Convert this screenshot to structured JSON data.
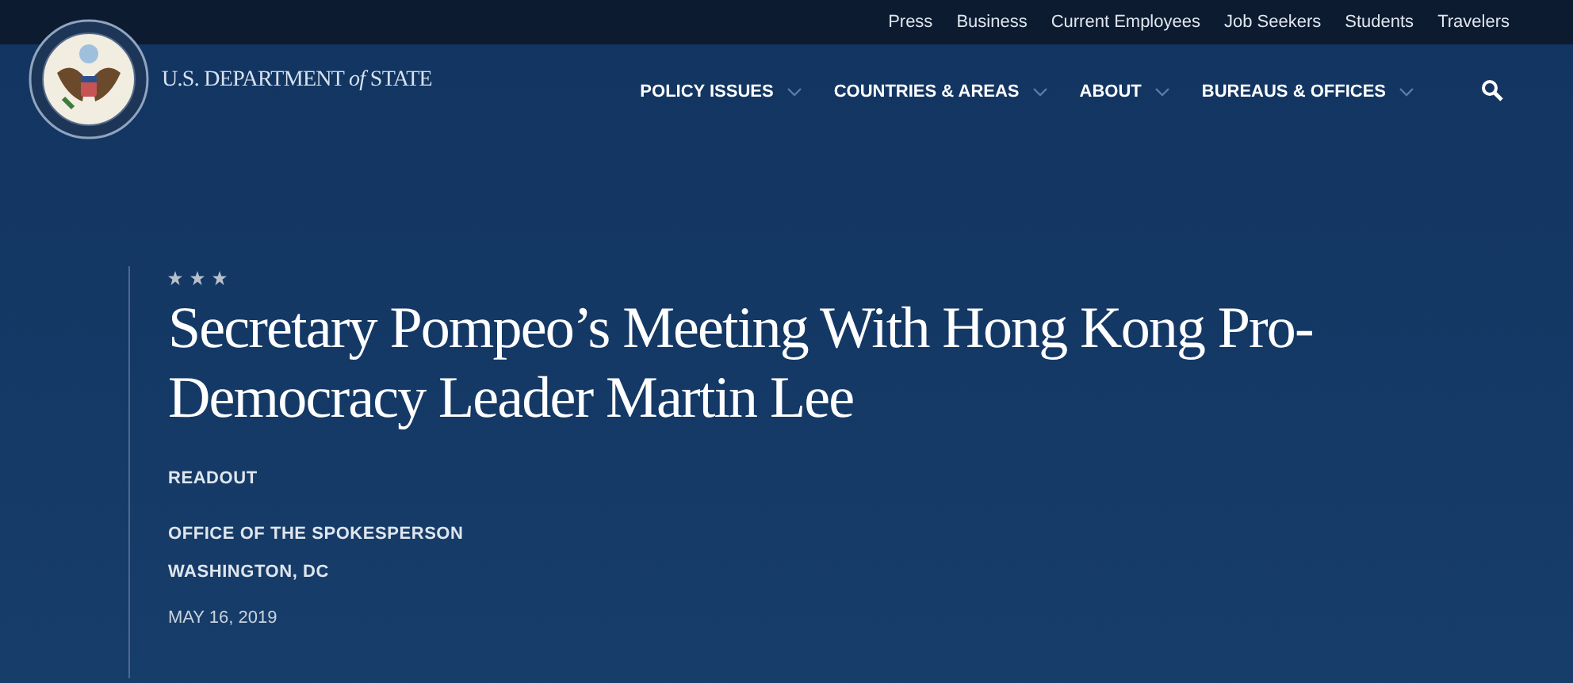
{
  "utility_nav": [
    "Press",
    "Business",
    "Current Employees",
    "Job Seekers",
    "Students",
    "Travelers"
  ],
  "site_name": "U.S. DEPARTMENT *of* STATE",
  "main_nav": [
    "POLICY ISSUES",
    "COUNTRIES & AREAS",
    "ABOUT",
    "BUREAUS & OFFICES"
  ],
  "article": {
    "title": "Secretary Pompeo’s Meeting With Hong Kong Pro-Democracy Leader Martin Lee",
    "type": "READOUT",
    "office": "OFFICE OF THE SPOKESPERSON",
    "location": "WASHINGTON, DC",
    "date": "MAY 16, 2019"
  }
}
